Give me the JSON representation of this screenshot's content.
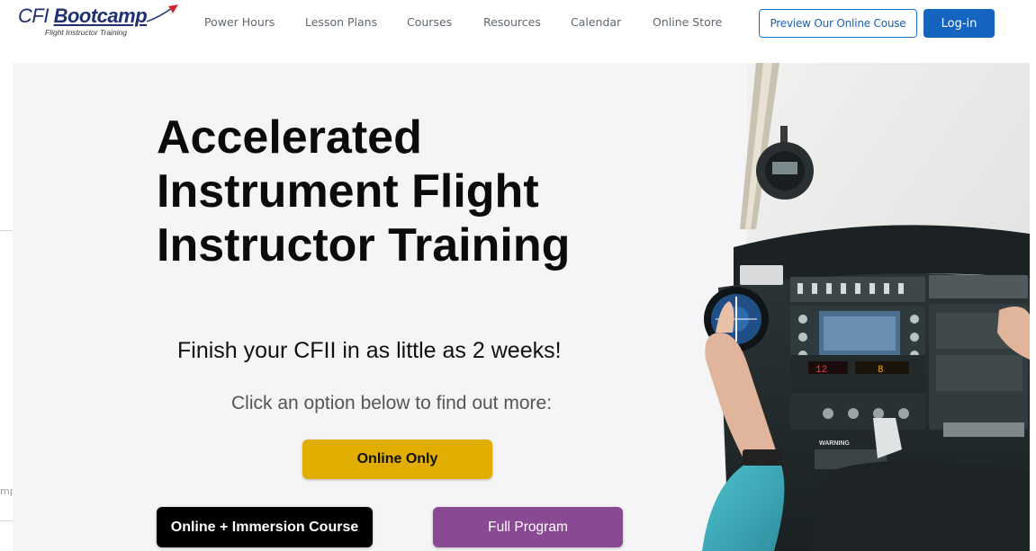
{
  "header": {
    "logo": {
      "cfi": "CFI",
      "bootcamp": "Bootcamp",
      "tagline": "Flight Instructor Training"
    },
    "nav": [
      {
        "label": "Power Hours"
      },
      {
        "label": "Lesson Plans"
      },
      {
        "label": "Courses"
      },
      {
        "label": "Resources"
      },
      {
        "label": "Calendar"
      },
      {
        "label": "Online Store"
      }
    ],
    "preview_label": "Preview Our Online Couse",
    "login_label": "Log-in"
  },
  "hero": {
    "title_lines": [
      "Accelerated",
      "Instrument Flight",
      "Instructor Training"
    ],
    "subtitle": "Finish your CFII in as little as 2 weeks!",
    "prompt": "Click an option below to find out more:",
    "buttons": {
      "online_only": "Online Only",
      "immersion": "Online + Immersion Course",
      "full_program": "Full Program"
    },
    "left_fragment": "mp",
    "image": {
      "panel_warning": "WARNING",
      "freq_left": "12",
      "freq_right": "8"
    }
  },
  "colors": {
    "brand_navy": "#1f2f73",
    "login_blue": "#1565c0",
    "online_only_gold": "#e0ad00",
    "immersion_black": "#000000",
    "full_program_purple": "#8a4a93",
    "hero_bg": "#f5f5f7"
  }
}
